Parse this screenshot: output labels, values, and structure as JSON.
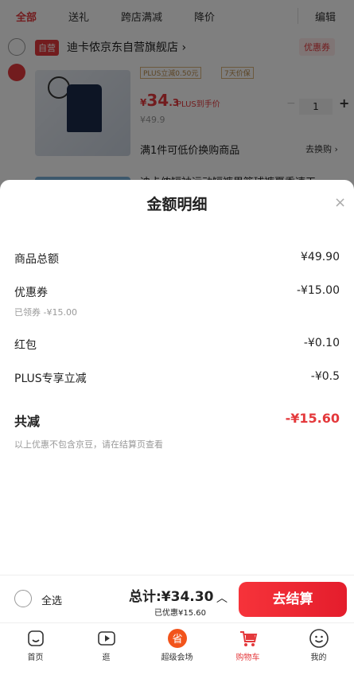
{
  "top_tabs": {
    "items": [
      "全部",
      "送礼",
      "跨店满减",
      "降价"
    ],
    "edit": "编辑"
  },
  "store": {
    "badge": "自营",
    "name": "迪卡侬京东自营旗舰店",
    "chevron": "›",
    "coupon": "优惠券"
  },
  "product": {
    "plus_tag": "PLUS立減0.50元",
    "return_tag": "7天价保",
    "price_symbol": "¥",
    "price_int": "34",
    "price_dec": ".3",
    "plus_price_label": "PLUS到手价",
    "orig_price": "¥49.9",
    "qty": "1",
    "qty_minus": "−",
    "qty_plus": "+",
    "promo": "满1件可低价换购商品",
    "promo_link": "去换购 ›",
    "next_title": "迪卡侬短袖运动短裤男篮球裤夏季速干"
  },
  "sheet": {
    "title": "金额明细",
    "close": "×",
    "rows": [
      {
        "label": "商品总额",
        "value": "¥49.90"
      },
      {
        "label": "优惠券",
        "value": "-¥15.00",
        "sub": "已领券 -¥15.00"
      },
      {
        "label": "红包",
        "value": "-¥0.10"
      },
      {
        "label": "PLUS专享立减",
        "value": "-¥0.5"
      }
    ],
    "total_label": "共减",
    "total_value": "-¥15.60",
    "note": "以上优惠不包含京豆，请在结算页查看"
  },
  "action_bar": {
    "select_all": "全选",
    "total": "总计:¥34.30",
    "saved": "已优惠¥15.60",
    "caret": "︿",
    "checkout": "去结算"
  },
  "bottom_nav": [
    {
      "label": "首页",
      "icon": "home-icon"
    },
    {
      "label": "逛",
      "icon": "video-icon"
    },
    {
      "label": "超级会场",
      "icon": "super-venue-icon"
    },
    {
      "label": "购物车",
      "icon": "cart-icon"
    },
    {
      "label": "我的",
      "icon": "profile-icon"
    }
  ],
  "colors": {
    "accent": "#e4393c",
    "checkout_gradient_start": "#f6333a",
    "checkout_gradient_end": "#e41d2c",
    "overlay": "rgba(0,0,0,0.5)"
  }
}
